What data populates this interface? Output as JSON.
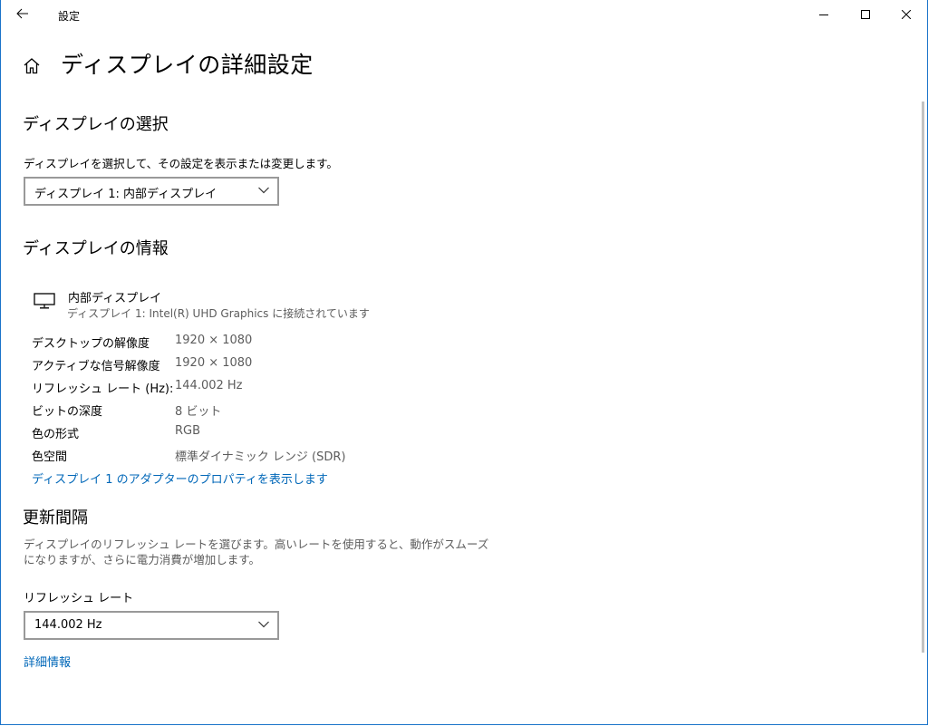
{
  "window": {
    "title": "設定"
  },
  "page": {
    "title": "ディスプレイの詳細設定"
  },
  "select_display": {
    "heading": "ディスプレイの選択",
    "description": "ディスプレイを選択して、その設定を表示または変更します。",
    "selected": "ディスプレイ 1: 内部ディスプレイ"
  },
  "display_info": {
    "heading": "ディスプレイの情報",
    "monitor_name": "内部ディスプレイ",
    "monitor_sub": "ディスプレイ 1: Intel(R) UHD Graphics に接続されています",
    "rows": [
      {
        "label": "デスクトップの解像度",
        "value": "1920 × 1080"
      },
      {
        "label": "アクティブな信号解像度",
        "value": "1920 × 1080"
      },
      {
        "label": "リフレッシュ レート (Hz):",
        "value": "144.002 Hz"
      },
      {
        "label": "ビットの深度",
        "value": "8 ビット"
      },
      {
        "label": "色の形式",
        "value": "RGB"
      },
      {
        "label": "色空間",
        "value": "標準ダイナミック レンジ (SDR)"
      }
    ],
    "adapter_link": "ディスプレイ 1 のアダプターのプロパティを表示します"
  },
  "refresh": {
    "heading": "更新間隔",
    "description_line1": "ディスプレイのリフレッシュ レートを選びます。高いレートを使用すると、動作がスムーズ",
    "description_line2": "になりますが、さらに電力消費が増加します。",
    "rate_label": "リフレッシュ レート",
    "selected_rate": "144.002 Hz",
    "more_info_link": "詳細情報"
  },
  "colors": {
    "accent": "#0067b8",
    "window_border": "#1a73c9"
  },
  "icons": [
    "back-arrow-icon",
    "minimize-icon",
    "maximize-icon",
    "close-icon",
    "home-icon",
    "chevron-down-icon",
    "monitor-icon"
  ]
}
